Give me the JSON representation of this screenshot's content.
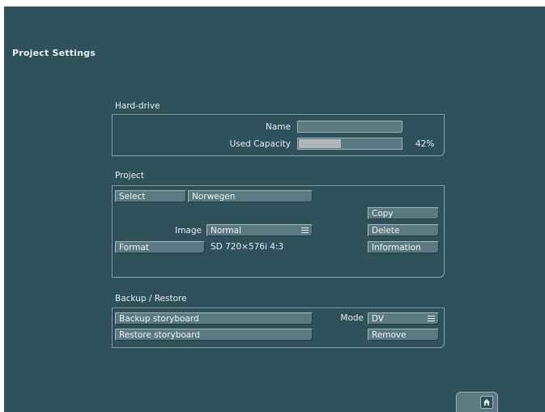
{
  "page_title": "Project Settings",
  "hard_drive": {
    "section_label": "Hard-drive",
    "name_label": "Name",
    "name_value": "",
    "used_capacity_label": "Used Capacity",
    "used_capacity_percent": 42,
    "used_capacity_text": "42%"
  },
  "project": {
    "section_label": "Project",
    "select_button": "Select",
    "project_name": "Norwegen",
    "image_label": "Image",
    "image_value": "Normal",
    "format_button": "Format",
    "format_value": "SD 720×576i 4:3",
    "copy_button": "Copy",
    "delete_button": "Delete",
    "information_button": "Information"
  },
  "backup": {
    "section_label": "Backup / Restore",
    "backup_button": "Backup storyboard",
    "restore_button": "Restore storyboard",
    "mode_label": "Mode",
    "mode_value": "DV",
    "remove_button": "Remove"
  },
  "icons": {
    "home": "home-icon",
    "menu": "menu-lines-icon"
  }
}
